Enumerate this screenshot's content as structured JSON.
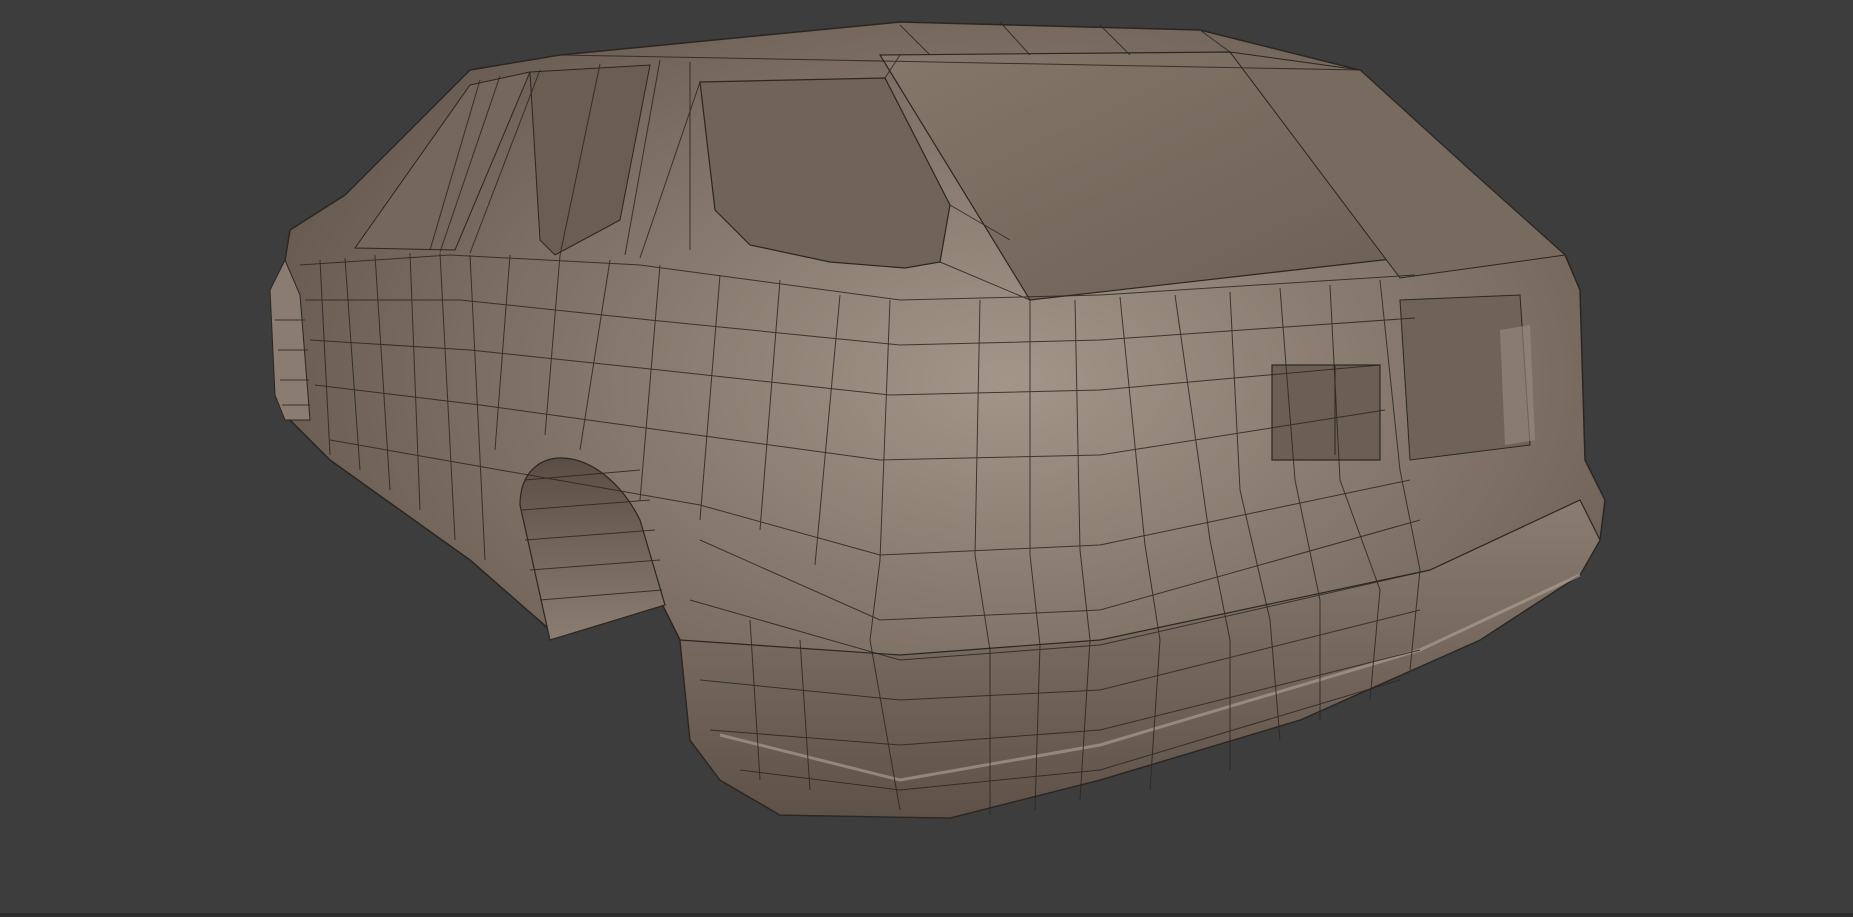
{
  "viewport": {
    "background_color": "#3d3d3d",
    "mesh_color": "#7a6c60",
    "wire_color": "#2b2622"
  },
  "object": {
    "icon": "car-mesh-icon"
  }
}
